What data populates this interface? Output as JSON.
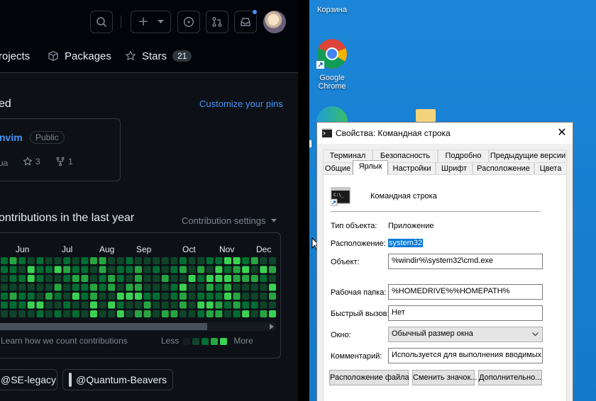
{
  "github": {
    "nav": {
      "projects": "rojects",
      "packages": "Packages",
      "stars": "Stars",
      "stars_count": "21"
    },
    "pinned": {
      "heading_fragment": "ed",
      "customize_link": "Customize your pins",
      "repo_name": "nvim",
      "repo_visibility": "Public",
      "repo_lang_fragment": "ua",
      "repo_stars": "3",
      "repo_forks": "1"
    },
    "contributions": {
      "heading": "ontributions in the last year",
      "settings": "Contribution settings",
      "months": [
        "Jun",
        "Jul",
        "Aug",
        "Sep",
        "Oct",
        "Nov",
        "Dec"
      ],
      "learn_link": "Learn how we count contributions",
      "less": "Less",
      "more": "More",
      "legend_colors": [
        "#161b22",
        "#0e4429",
        "#006d32",
        "#26a641",
        "#39d353"
      ]
    },
    "orgs": [
      "@SE-legacy",
      "@Quantum-Beavers"
    ]
  },
  "desktop": {
    "recycle_bin": "Корзина",
    "chrome_label": "Google Chrome"
  },
  "dialog": {
    "title": "Свойства: Командная строка",
    "tabs_row1": [
      "Терминал",
      "Безопасность",
      "Подробно",
      "Предыдущие версии"
    ],
    "tabs_row2": [
      "Общие",
      "Ярлык",
      "Настройки",
      "Шрифт",
      "Расположение",
      "Цвета"
    ],
    "active_tab": "Ярлык",
    "shortcut_name": "Командная строка",
    "object_type_label": "Тип объекта:",
    "object_type_value": "Приложение",
    "location_label": "Расположение:",
    "location_value": "system32",
    "target_label": "Объект:",
    "target_value": "%windir%\\system32\\cmd.exe",
    "start_in_label": "Рабочая папка:",
    "start_in_value": "%HOMEDRIVE%%HOMEPATH%",
    "hotkey_label": "Быстрый вызов:",
    "hotkey_value": "Нет",
    "run_label": "Окно:",
    "run_value": "Обычный размер окна",
    "comment_label": "Комментарий:",
    "comment_value": "Используется для выполнения вводимых с кла",
    "btn_open_location": "Расположение файла",
    "btn_change_icon": "Сменить значок...",
    "btn_advanced": "Дополнительно..."
  }
}
